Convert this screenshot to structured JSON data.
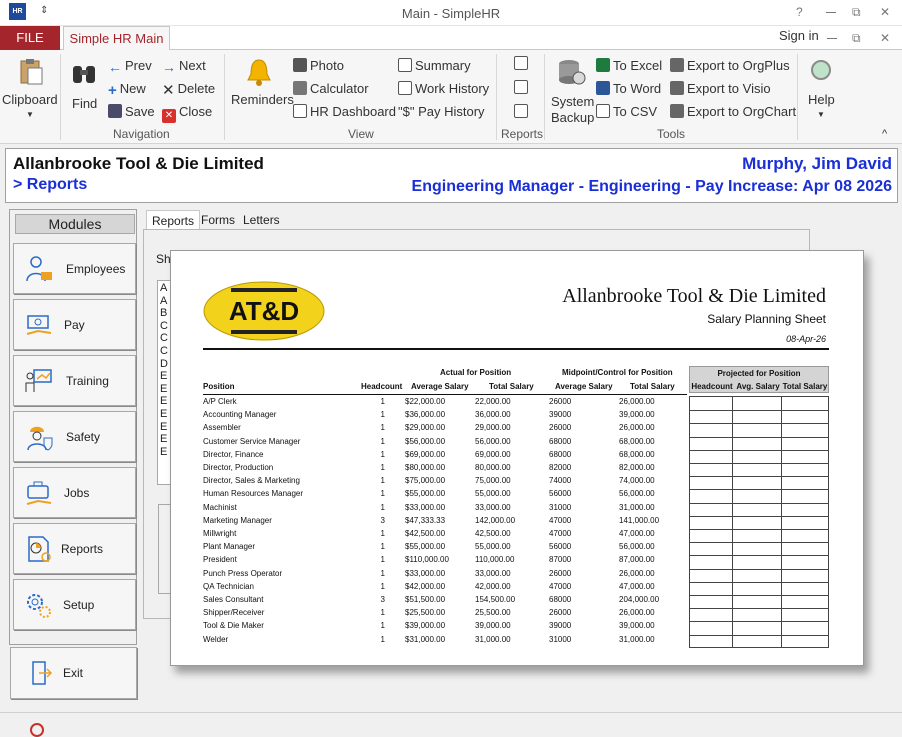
{
  "window": {
    "title": "Main - SimpleHR",
    "logo_text": "HR",
    "qat_glyph": "⇕",
    "help_glyph": "?",
    "restore_glyph": "⧉",
    "close_glyph": "✕",
    "ribbon_collapse_glyph": "^"
  },
  "tabs": {
    "file": "FILE",
    "main": "Simple HR Main",
    "signin": "Sign in"
  },
  "ribbon": {
    "clipboard": "Clipboard",
    "find": "Find",
    "prev": "Prev",
    "next": "Next",
    "new": "New",
    "delete": "Delete",
    "save": "Save",
    "close": "Close",
    "reminders": "Reminders",
    "photo": "Photo",
    "calculator": "Calculator",
    "hr_dashboard": "HR Dashboard",
    "summary": "Summary",
    "work_history": "Work History",
    "pay_history": "\"$\" Pay History",
    "system_backup_1": "System",
    "system_backup_2": "Backup",
    "to_excel": "To Excel",
    "to_word": "To Word",
    "to_csv": "To CSV",
    "export_orgplus": "Export to OrgPlus",
    "export_visio": "Export to Visio",
    "export_orgchart": "Export to OrgChart",
    "help": "Help",
    "groups": {
      "navigation": "Navigation",
      "view": "View",
      "reports": "Reports",
      "tools": "Tools"
    }
  },
  "header": {
    "company": "Allanbrooke Tool & Die Limited",
    "breadcrumb": "> Reports",
    "employee": "Murphy, Jim David",
    "role": "Engineering Manager - Engineering - Pay Increase: Apr 08 2026"
  },
  "modules": {
    "title": "Modules",
    "items": [
      "Employees",
      "Pay",
      "Training",
      "Safety",
      "Jobs",
      "Reports",
      "Setup"
    ],
    "exit": "Exit"
  },
  "subtabs": [
    "Reports",
    "Forms",
    "Letters"
  ],
  "content": {
    "partial_label": "Sh",
    "list_fragments": "A\nA\nB\nC\nC\nC\nD\nE\nE\nE\nE\nE\nE\nE"
  },
  "report": {
    "company": "Allanbrooke Tool & Die Limited",
    "subtitle": "Salary Planning Sheet",
    "date": "08-Apr-26",
    "logo_text": "AT&D",
    "group_actual": "Actual for Position",
    "group_midpoint": "Midpoint/Control for Position",
    "group_projected": "Projected for Position",
    "col_position": "Position",
    "col_headcount": "Headcount",
    "col_avg_salary": "Average Salary",
    "col_total_salary": "Total Salary",
    "col_proj_headcount": "Headcount",
    "col_proj_avg": "Avg. Salary",
    "col_proj_total": "Total Salary",
    "rows": [
      {
        "position": "A/P Clerk",
        "headcount": "1",
        "avg": "$22,000.00",
        "total": "22,000.00",
        "mid_avg": "26000",
        "mid_total": "26,000.00"
      },
      {
        "position": "Accounting Manager",
        "headcount": "1",
        "avg": "$36,000.00",
        "total": "36,000.00",
        "mid_avg": "39000",
        "mid_total": "39,000.00"
      },
      {
        "position": "Assembler",
        "headcount": "1",
        "avg": "$29,000.00",
        "total": "29,000.00",
        "mid_avg": "26000",
        "mid_total": "26,000.00"
      },
      {
        "position": "Customer Service Manager",
        "headcount": "1",
        "avg": "$56,000.00",
        "total": "56,000.00",
        "mid_avg": "68000",
        "mid_total": "68,000.00"
      },
      {
        "position": "Director, Finance",
        "headcount": "1",
        "avg": "$69,000.00",
        "total": "69,000.00",
        "mid_avg": "68000",
        "mid_total": "68,000.00"
      },
      {
        "position": "Director, Production",
        "headcount": "1",
        "avg": "$80,000.00",
        "total": "80,000.00",
        "mid_avg": "82000",
        "mid_total": "82,000.00"
      },
      {
        "position": "Director, Sales & Marketing",
        "headcount": "1",
        "avg": "$75,000.00",
        "total": "75,000.00",
        "mid_avg": "74000",
        "mid_total": "74,000.00"
      },
      {
        "position": "Human Resources Manager",
        "headcount": "1",
        "avg": "$55,000.00",
        "total": "55,000.00",
        "mid_avg": "56000",
        "mid_total": "56,000.00"
      },
      {
        "position": "Machinist",
        "headcount": "1",
        "avg": "$33,000.00",
        "total": "33,000.00",
        "mid_avg": "31000",
        "mid_total": "31,000.00"
      },
      {
        "position": "Marketing Manager",
        "headcount": "3",
        "avg": "$47,333.33",
        "total": "142,000.00",
        "mid_avg": "47000",
        "mid_total": "141,000.00"
      },
      {
        "position": "Millwright",
        "headcount": "1",
        "avg": "$42,500.00",
        "total": "42,500.00",
        "mid_avg": "47000",
        "mid_total": "47,000.00"
      },
      {
        "position": "Plant Manager",
        "headcount": "1",
        "avg": "$55,000.00",
        "total": "55,000.00",
        "mid_avg": "56000",
        "mid_total": "56,000.00"
      },
      {
        "position": "President",
        "headcount": "1",
        "avg": "$110,000.00",
        "total": "110,000.00",
        "mid_avg": "87000",
        "mid_total": "87,000.00"
      },
      {
        "position": "Punch Press Operator",
        "headcount": "1",
        "avg": "$33,000.00",
        "total": "33,000.00",
        "mid_avg": "26000",
        "mid_total": "26,000.00"
      },
      {
        "position": "QA Technician",
        "headcount": "1",
        "avg": "$42,000.00",
        "total": "42,000.00",
        "mid_avg": "47000",
        "mid_total": "47,000.00"
      },
      {
        "position": "Sales Consultant",
        "headcount": "3",
        "avg": "$51,500.00",
        "total": "154,500.00",
        "mid_avg": "68000",
        "mid_total": "204,000.00"
      },
      {
        "position": "Shipper/Receiver",
        "headcount": "1",
        "avg": "$25,500.00",
        "total": "25,500.00",
        "mid_avg": "26000",
        "mid_total": "26,000.00"
      },
      {
        "position": "Tool & Die Maker",
        "headcount": "1",
        "avg": "$39,000.00",
        "total": "39,000.00",
        "mid_avg": "39000",
        "mid_total": "39,000.00"
      },
      {
        "position": "Welder",
        "headcount": "1",
        "avg": "$31,000.00",
        "total": "31,000.00",
        "mid_avg": "31000",
        "mid_total": "31,000.00"
      }
    ]
  },
  "colors": {
    "accent": "#a4262c",
    "link_blue": "#1a2fd6",
    "logo_yellow": "#f2d21b"
  }
}
